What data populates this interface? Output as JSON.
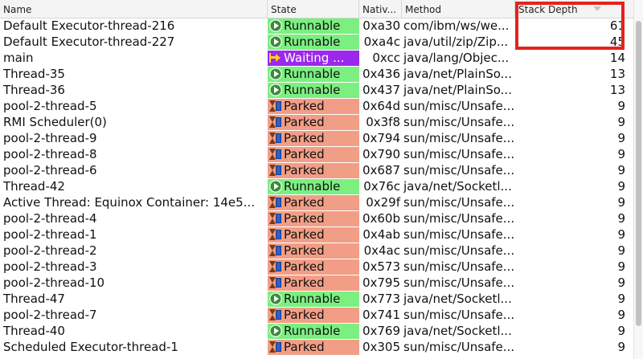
{
  "columns": {
    "name": "Name",
    "state": "State",
    "native": "Nativ...",
    "method": "Method",
    "depth": "Stack Depth"
  },
  "state_colors": {
    "runnable": "#7bef80",
    "parked": "#f29e86",
    "waiting": "#9b28ec"
  },
  "highlight_color": "#e3241c",
  "rows": [
    {
      "name": "Default Executor-thread-216",
      "state": "Runnable",
      "state_icon": "play-icon",
      "native": "0xa30",
      "method": "com/ibm/ws/we...",
      "depth": "61"
    },
    {
      "name": "Default Executor-thread-227",
      "state": "Runnable",
      "state_icon": "play-icon",
      "native": "0xa4c",
      "method": "java/util/zip/Zip...",
      "depth": "45"
    },
    {
      "name": "main",
      "state": "Waiting ...",
      "state_icon": "arrow-icon",
      "native": "0xcc",
      "method": "java/lang/Objec...",
      "depth": "14"
    },
    {
      "name": "Thread-35",
      "state": "Runnable",
      "state_icon": "play-icon",
      "native": "0x436",
      "method": "java/net/PlainSo...",
      "depth": "13"
    },
    {
      "name": "Thread-36",
      "state": "Runnable",
      "state_icon": "play-icon",
      "native": "0x437",
      "method": "java/net/PlainSo...",
      "depth": "13"
    },
    {
      "name": "pool-2-thread-5",
      "state": "Parked",
      "state_icon": "hourglass-icon",
      "native": "0x64d",
      "method": "sun/misc/Unsafe...",
      "depth": "9"
    },
    {
      "name": "RMI Scheduler(0)",
      "state": "Parked",
      "state_icon": "hourglass-icon",
      "native": "0x3f8",
      "method": "sun/misc/Unsafe...",
      "depth": "9"
    },
    {
      "name": "pool-2-thread-9",
      "state": "Parked",
      "state_icon": "hourglass-icon",
      "native": "0x794",
      "method": "sun/misc/Unsafe...",
      "depth": "9"
    },
    {
      "name": "pool-2-thread-8",
      "state": "Parked",
      "state_icon": "hourglass-icon",
      "native": "0x790",
      "method": "sun/misc/Unsafe...",
      "depth": "9"
    },
    {
      "name": "pool-2-thread-6",
      "state": "Parked",
      "state_icon": "hourglass-icon",
      "native": "0x687",
      "method": "sun/misc/Unsafe...",
      "depth": "9"
    },
    {
      "name": "Thread-42",
      "state": "Runnable",
      "state_icon": "play-icon",
      "native": "0x76c",
      "method": "java/net/Socketl...",
      "depth": "9"
    },
    {
      "name": "Active Thread: Equinox Container: 14e5...",
      "state": "Parked",
      "state_icon": "hourglass-icon",
      "native": "0x29f",
      "method": "sun/misc/Unsafe...",
      "depth": "9"
    },
    {
      "name": "pool-2-thread-4",
      "state": "Parked",
      "state_icon": "hourglass-icon",
      "native": "0x60b",
      "method": "sun/misc/Unsafe...",
      "depth": "9"
    },
    {
      "name": "pool-2-thread-1",
      "state": "Parked",
      "state_icon": "hourglass-icon",
      "native": "0x4ab",
      "method": "sun/misc/Unsafe...",
      "depth": "9"
    },
    {
      "name": "pool-2-thread-2",
      "state": "Parked",
      "state_icon": "hourglass-icon",
      "native": "0x4ac",
      "method": "sun/misc/Unsafe...",
      "depth": "9"
    },
    {
      "name": "pool-2-thread-3",
      "state": "Parked",
      "state_icon": "hourglass-icon",
      "native": "0x573",
      "method": "sun/misc/Unsafe...",
      "depth": "9"
    },
    {
      "name": "pool-2-thread-10",
      "state": "Parked",
      "state_icon": "hourglass-icon",
      "native": "0x795",
      "method": "sun/misc/Unsafe...",
      "depth": "9"
    },
    {
      "name": "Thread-47",
      "state": "Runnable",
      "state_icon": "play-icon",
      "native": "0x773",
      "method": "java/net/Socketl...",
      "depth": "9"
    },
    {
      "name": "pool-2-thread-7",
      "state": "Parked",
      "state_icon": "hourglass-icon",
      "native": "0x741",
      "method": "sun/misc/Unsafe...",
      "depth": "9"
    },
    {
      "name": "Thread-40",
      "state": "Runnable",
      "state_icon": "play-icon",
      "native": "0x769",
      "method": "java/net/Socketl...",
      "depth": "9"
    },
    {
      "name": "Scheduled Executor-thread-1",
      "state": "Parked",
      "state_icon": "hourglass-icon",
      "native": "0x305",
      "method": "sun/misc/Unsafe...",
      "depth": "9"
    }
  ]
}
